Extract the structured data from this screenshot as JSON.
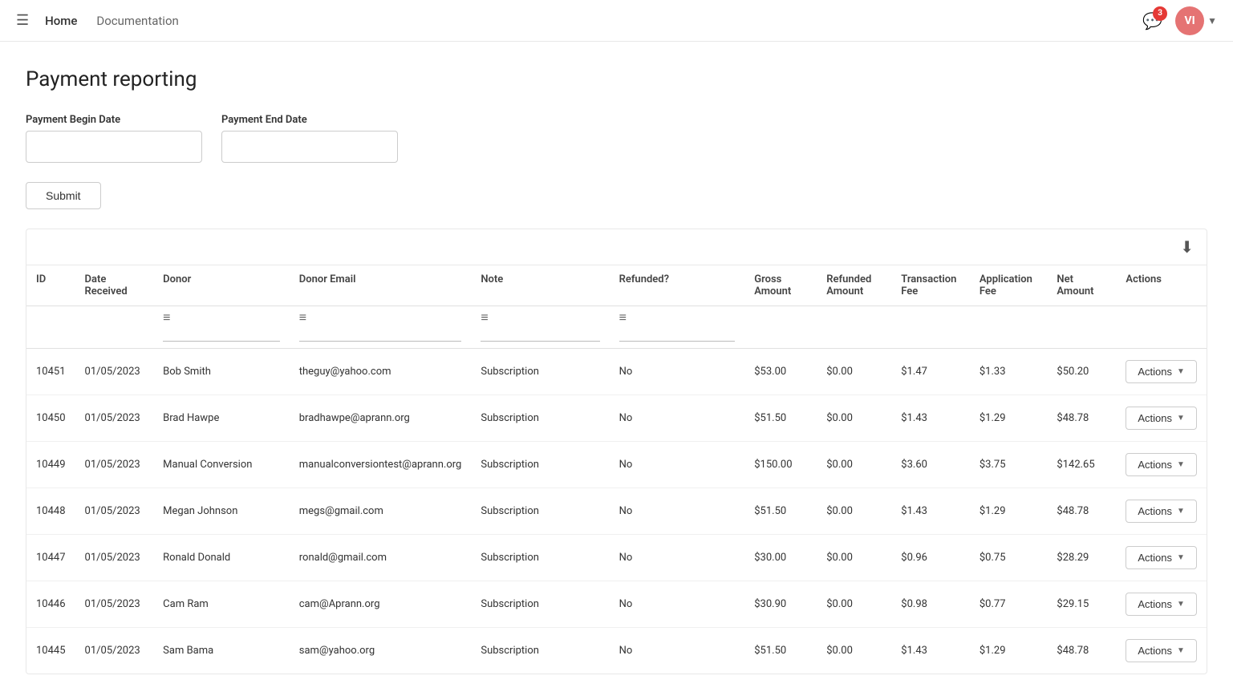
{
  "nav": {
    "hamburger": "☰",
    "home": "Home",
    "documentation": "Documentation",
    "badge_count": "3",
    "avatar_initials": "VI"
  },
  "page": {
    "title": "Payment reporting",
    "begin_date_label": "Payment Begin Date",
    "end_date_label": "Payment End Date",
    "begin_date_placeholder": "",
    "end_date_placeholder": "",
    "submit_label": "Submit"
  },
  "table": {
    "download_icon": "⬇",
    "columns": [
      "ID",
      "Date Received",
      "Donor",
      "Donor Email",
      "Note",
      "Refunded?",
      "Gross Amount",
      "Refunded Amount",
      "Transaction Fee",
      "Application Fee",
      "Net Amount",
      "Actions"
    ],
    "rows": [
      {
        "id": "10451",
        "date": "01/05/2023",
        "donor": "Bob Smith",
        "email": "theguy@yahoo.com",
        "note": "Subscription",
        "refunded": "No",
        "gross": "$53.00",
        "refunded_amt": "$0.00",
        "transaction_fee": "$1.47",
        "application_fee": "$1.33",
        "net": "$50.20",
        "actions": "Actions"
      },
      {
        "id": "10450",
        "date": "01/05/2023",
        "donor": "Brad Hawpe",
        "email": "bradhawpe@aprann.org",
        "note": "Subscription",
        "refunded": "No",
        "gross": "$51.50",
        "refunded_amt": "$0.00",
        "transaction_fee": "$1.43",
        "application_fee": "$1.29",
        "net": "$48.78",
        "actions": "Actions"
      },
      {
        "id": "10449",
        "date": "01/05/2023",
        "donor": "Manual Conversion",
        "email": "manualconversiontest@aprann.org",
        "note": "Subscription",
        "refunded": "No",
        "gross": "$150.00",
        "refunded_amt": "$0.00",
        "transaction_fee": "$3.60",
        "application_fee": "$3.75",
        "net": "$142.65",
        "actions": "Actions"
      },
      {
        "id": "10448",
        "date": "01/05/2023",
        "donor": "Megan Johnson",
        "email": "megs@gmail.com",
        "note": "Subscription",
        "refunded": "No",
        "gross": "$51.50",
        "refunded_amt": "$0.00",
        "transaction_fee": "$1.43",
        "application_fee": "$1.29",
        "net": "$48.78",
        "actions": "Actions"
      },
      {
        "id": "10447",
        "date": "01/05/2023",
        "donor": "Ronald Donald",
        "email": "ronald@gmail.com",
        "note": "Subscription",
        "refunded": "No",
        "gross": "$30.00",
        "refunded_amt": "$0.00",
        "transaction_fee": "$0.96",
        "application_fee": "$0.75",
        "net": "$28.29",
        "actions": "Actions"
      },
      {
        "id": "10446",
        "date": "01/05/2023",
        "donor": "Cam Ram",
        "email": "cam@Aprann.org",
        "note": "Subscription",
        "refunded": "No",
        "gross": "$30.90",
        "refunded_amt": "$0.00",
        "transaction_fee": "$0.98",
        "application_fee": "$0.77",
        "net": "$29.15",
        "actions": "Actions"
      },
      {
        "id": "10445",
        "date": "01/05/2023",
        "donor": "Sam Bama",
        "email": "sam@yahoo.org",
        "note": "Subscription",
        "refunded": "No",
        "gross": "$51.50",
        "refunded_amt": "$0.00",
        "transaction_fee": "$1.43",
        "application_fee": "$1.29",
        "net": "$48.78",
        "actions": "Actions"
      }
    ]
  }
}
